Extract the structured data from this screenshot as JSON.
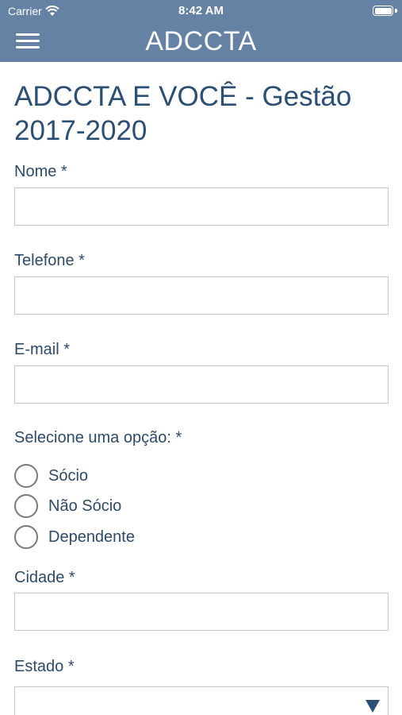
{
  "status_bar": {
    "carrier": "Carrier",
    "time": "8:42 AM"
  },
  "header": {
    "title": "ADCCTA"
  },
  "form": {
    "heading": "ADCCTA E VOCÊ - Gestão 2017-2020",
    "nome_label": "Nome *",
    "nome_value": "",
    "telefone_label": "Telefone *",
    "telefone_value": "",
    "email_label": "E-mail *",
    "email_value": "",
    "option_label": "Selecione uma opção: *",
    "options": [
      "Sócio",
      "Não Sócio",
      "Dependente"
    ],
    "cidade_label": "Cidade *",
    "cidade_value": "",
    "estado_label": "Estado *",
    "estado_value": ""
  },
  "colors": {
    "header_bg": "#6581a3",
    "text": "#2d4a6b",
    "accent": "#2c4f75"
  }
}
